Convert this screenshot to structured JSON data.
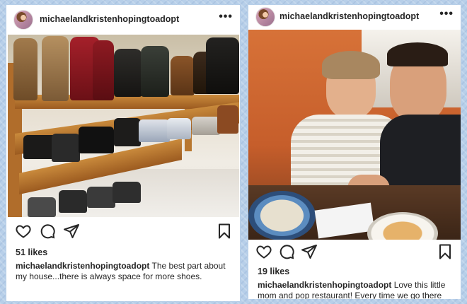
{
  "posts": [
    {
      "username": "michaelandkristenhopingtoadopt",
      "more_icon": "more-horizontal-icon",
      "likes": "51 likes",
      "caption_user": "michaelandkristenhopingtoadopt",
      "caption_text": "The best part about my house...there is always space for more shoes."
    },
    {
      "username": "michaelandkristenhopingtoadopt",
      "more_icon": "more-horizontal-icon",
      "likes": "19 likes",
      "caption_user": "michaelandkristenhopingtoadopt",
      "caption_text": "Love this little mom and pop restaurant! Every time we go there"
    }
  ],
  "icons": {
    "like": "heart-icon",
    "comment": "comment-icon",
    "share": "share-icon",
    "save": "bookmark-icon",
    "more": "ellipsis-icon"
  },
  "more_glyph": "•••",
  "colors": {
    "text": "#262626",
    "card": "#ffffff",
    "background": "#b7cfe9"
  }
}
